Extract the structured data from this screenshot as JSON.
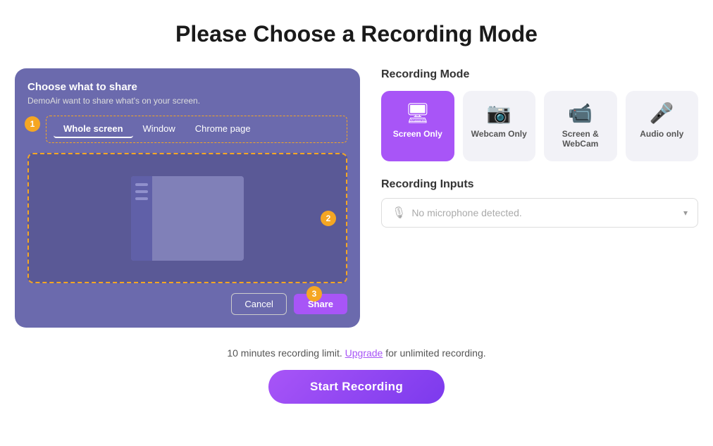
{
  "page": {
    "title": "Please Choose a Recording Mode"
  },
  "left_panel": {
    "title": "Choose what to share",
    "subtitle": "DemoAir want to share what's on your screen.",
    "tabs": [
      "Whole screen",
      "Window",
      "Chrome page"
    ],
    "active_tab": "Whole screen",
    "cancel_label": "Cancel",
    "share_label": "Share",
    "badges": [
      "1",
      "2",
      "3"
    ]
  },
  "right_panel": {
    "recording_mode_label": "Recording Mode",
    "modes": [
      {
        "id": "screen-only",
        "label": "Screen Only",
        "icon": "🖥",
        "active": true
      },
      {
        "id": "webcam-only",
        "label": "Webcam Only",
        "icon": "📷",
        "active": false
      },
      {
        "id": "screen-webcam",
        "label": "Screen & WebCam",
        "icon": "📹",
        "active": false
      },
      {
        "id": "audio-only",
        "label": "Audio only",
        "icon": "🎤",
        "active": false
      }
    ],
    "recording_inputs_label": "Recording Inputs",
    "microphone_placeholder": "No microphone detected."
  },
  "footer": {
    "limit_text": "10 minutes recording limit.",
    "upgrade_label": "Upgrade",
    "unlimited_text": "for unlimited recording.",
    "start_label": "Start Recording"
  }
}
